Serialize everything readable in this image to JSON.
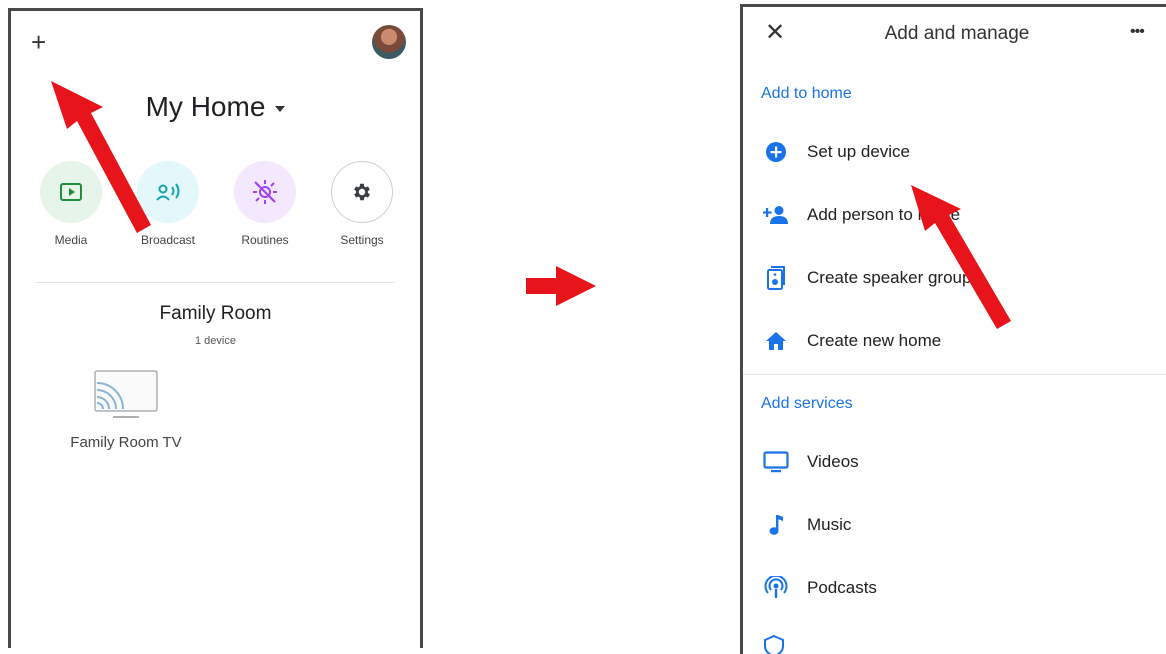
{
  "left_screen": {
    "home": {
      "title": "My Home"
    },
    "shortcuts": [
      {
        "label": "Media",
        "icon": "media-icon",
        "bg": "#e6f4ea",
        "color": "#1e8e3e"
      },
      {
        "label": "Broadcast",
        "icon": "broadcast-icon",
        "bg": "#e4f7fb",
        "color": "#12a4af"
      },
      {
        "label": "Routines",
        "icon": "routines-icon",
        "bg": "#f3e8fd",
        "color": "#a142f4"
      },
      {
        "label": "Settings",
        "icon": "gear-icon",
        "bg": "#ffffff",
        "color": "#3c4043"
      }
    ],
    "room": {
      "name": "Family Room",
      "count": "1 device"
    },
    "devices": [
      {
        "name": "Family Room TV",
        "icon": "cast-tv-icon"
      }
    ]
  },
  "right_screen": {
    "header": {
      "title": "Add and manage"
    },
    "sections": [
      {
        "title": "Add to home",
        "items": [
          {
            "label": "Set up device",
            "icon": "add-circle-icon"
          },
          {
            "label": "Add person to home",
            "icon": "add-person-icon"
          },
          {
            "label": "Create speaker group",
            "icon": "speaker-group-icon"
          },
          {
            "label": "Create new home",
            "icon": "home-icon"
          }
        ]
      },
      {
        "title": "Add services",
        "items": [
          {
            "label": "Videos",
            "icon": "tv-icon"
          },
          {
            "label": "Music",
            "icon": "music-note-icon"
          },
          {
            "label": "Podcasts",
            "icon": "podcast-icon"
          }
        ]
      }
    ]
  },
  "colors": {
    "accent": "#1a73e8",
    "annotation": "#e8141b",
    "frame": "#4a4a4a"
  }
}
